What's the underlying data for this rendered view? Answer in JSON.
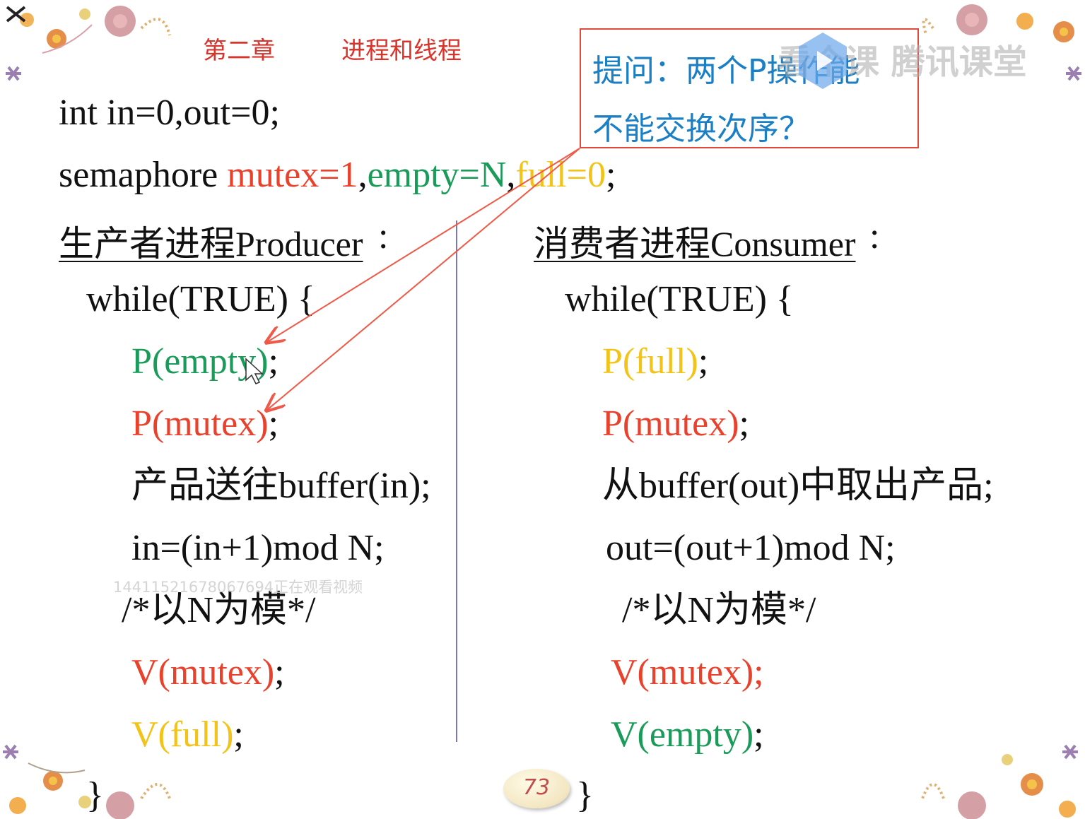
{
  "colors": {
    "red": "#e8412c",
    "green": "#1b9b5a",
    "yellow": "#f2c318",
    "blue_text": "#1a7fc4",
    "arrow": "#ef5a48",
    "divider": "#7878b8"
  },
  "header": {
    "chapter": "第二章",
    "title": "进程和线程"
  },
  "callout": {
    "line1": "提问：两个P操作能",
    "line2": "不能交换次序？"
  },
  "watermark": "看个课 腾讯课堂",
  "declarations": {
    "line1": "int in=0,out=0;",
    "semaphore_keyword": "semaphore ",
    "mutex": "mutex=1",
    "comma1": ",",
    "empty": "empty=N",
    "comma2": ",",
    "full": "full=0",
    "end": ";"
  },
  "producer": {
    "heading": "生产者进程Producer",
    "heading_colon": ":",
    "while_line": "while(TRUE) {",
    "p_empty": "P(empty)",
    "p_mutex": "P(mutex)",
    "put_item": "产品送往buffer(in);",
    "advance": "in=(in+1)mod N;",
    "comment": "/*以N为模*/",
    "v_mutex": "V(mutex)",
    "v_full": "V(full)",
    "semicolon": ";",
    "close_brace": "}"
  },
  "consumer": {
    "heading": "消费者进程Consumer",
    "heading_colon": ":",
    "while_line": "while(TRUE) {",
    "p_full": "P(full)",
    "p_mutex": "P(mutex)",
    "take_item": "从buffer(out)中取出产品;",
    "advance": "out=(out+1)mod N;",
    "comment": "/*以N为模*/",
    "v_mutex": "V(mutex);",
    "v_empty": "V(empty)",
    "semicolon": ";",
    "close_brace": "}"
  },
  "viewer_note": "14411521678067694正在观看视频",
  "page_number": "73"
}
